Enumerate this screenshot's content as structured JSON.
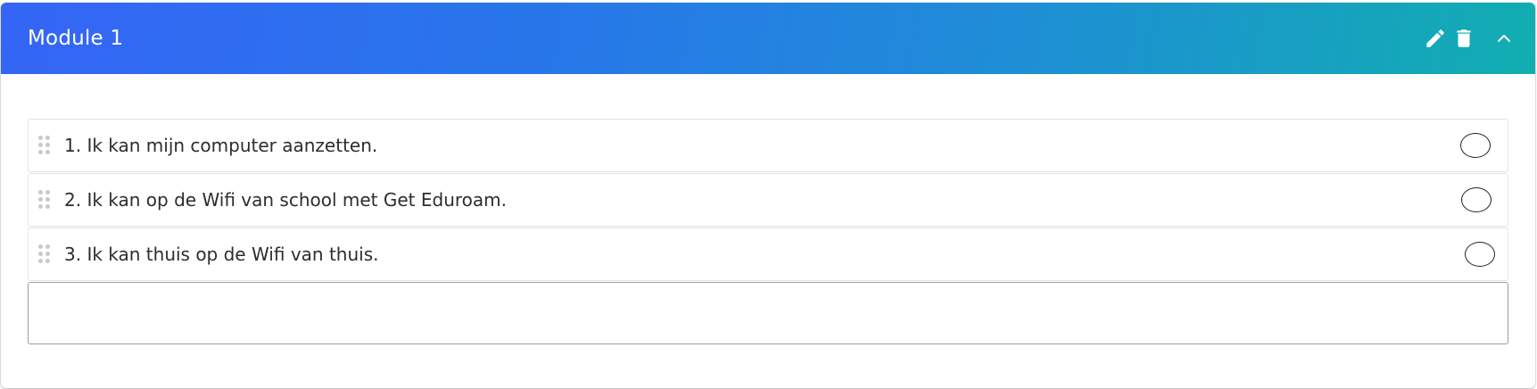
{
  "module": {
    "title": "Module 1",
    "header_gradient": [
      "#3565f6",
      "#11aeb1"
    ],
    "actions": [
      {
        "name": "edit-icon"
      },
      {
        "name": "trash-icon"
      },
      {
        "name": "chevron-up-icon"
      }
    ]
  },
  "items": [
    {
      "label": "1. Ik kan mijn computer aanzetten.",
      "checked": false
    },
    {
      "label": "2. Ik kan op de Wifi van school met Get Eduroam.",
      "checked": false
    },
    {
      "label": "3. Ik kan thuis op de Wifi van thuis.",
      "checked": false
    }
  ],
  "new_item": {
    "value": "",
    "placeholder": ""
  }
}
